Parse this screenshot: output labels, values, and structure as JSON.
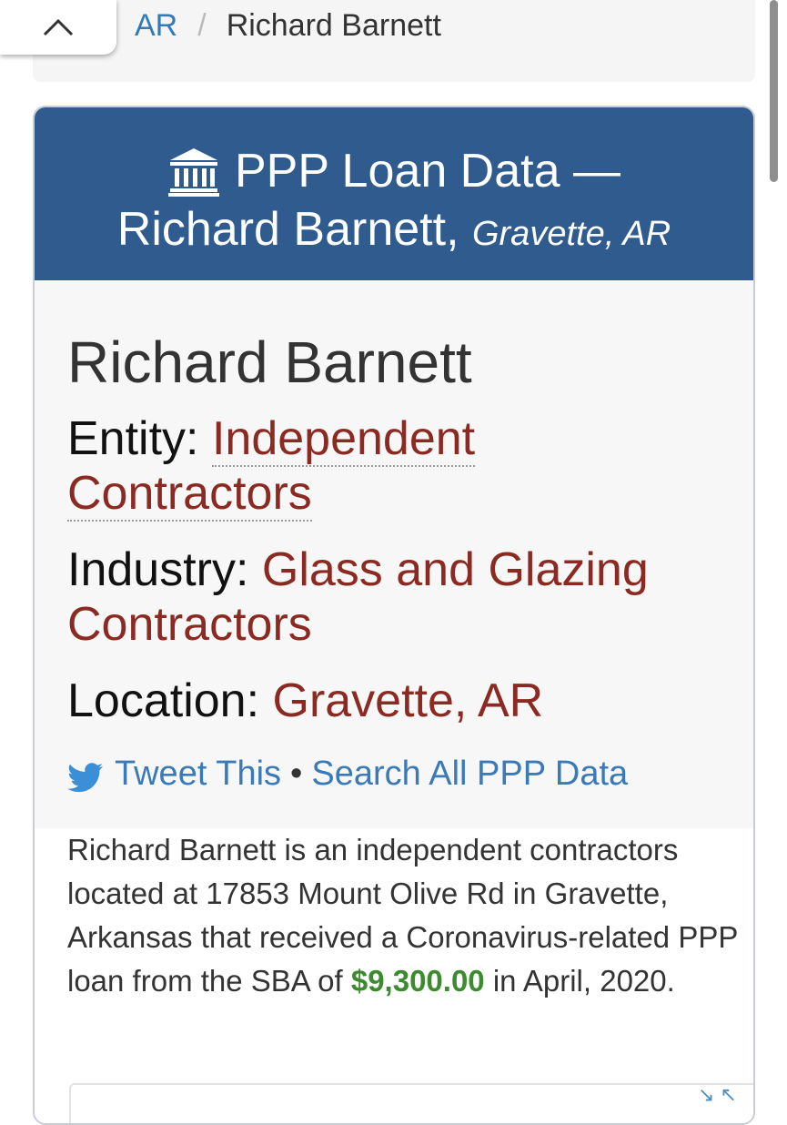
{
  "breadcrumb": {
    "state_link": "AR",
    "separator": "/",
    "current": "Richard Barnett"
  },
  "header": {
    "title_line1": "PPP Loan Data —",
    "title_name": "Richard Barnett,",
    "title_location": "Gravette, AR"
  },
  "business": {
    "name": "Richard Barnett",
    "entity_label": "Entity:",
    "entity_value": "Independent Contractors",
    "industry_label": "Industry:",
    "industry_value": "Glass and Glazing Contractors",
    "location_label": "Location:",
    "location_value": "Gravette, AR"
  },
  "share": {
    "tweet_label": "Tweet This",
    "separator": "•",
    "search_label": "Search All PPP Data"
  },
  "description": {
    "text_before": "Richard Barnett is an independent contractors located at 17853 Mount Olive Rd in Gravette, Arkansas that received a Coronavirus-related PPP loan from the SBA of ",
    "amount": "$9,300.00",
    "text_after": " in April, 2020."
  },
  "icons": {
    "up": "chevron-up-icon",
    "bank": "bank-icon",
    "twitter": "twitter-icon"
  },
  "colors": {
    "header_bg": "#2f5b8f",
    "link": "#337ab7",
    "value_red": "#8b2a22",
    "amount_green": "#3d8b2f"
  }
}
